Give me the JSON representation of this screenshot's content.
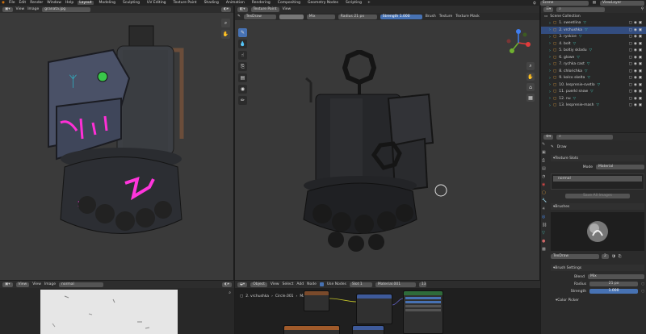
{
  "menu": {
    "items": [
      "File",
      "Edit",
      "Render",
      "Window",
      "Help"
    ],
    "workspaces": [
      "Layout",
      "Modeling",
      "Sculpting",
      "UV Editing",
      "Texture Paint",
      "Shading",
      "Animation",
      "Rendering",
      "Compositing",
      "Geometry Nodes",
      "Scripting"
    ],
    "active_workspace": "Layout",
    "scene_label": "Scene",
    "view_layer_label": "ViewLayer"
  },
  "left_viewport": {
    "header": {
      "view": "View",
      "image": "Image",
      "image_name": "granata.jpg"
    }
  },
  "texpaint_header": {
    "mode": "Texture Paint",
    "view": "View",
    "brush_name": "TexDraw",
    "blend": "Mix",
    "radius_label": "Radius",
    "radius_value": "21 px",
    "strength_label": "Strength",
    "strength_value": "1.000",
    "brush_menu": "Brush",
    "texture_menu": "Texture",
    "tex_mask_menu": "Texture Mask"
  },
  "outliner": {
    "title": "Scene Collection",
    "rows": [
      {
        "label": "1. sweetlina",
        "selected": false
      },
      {
        "label": "2. vrchushka",
        "selected": true
      },
      {
        "label": "3. ryskice",
        "selected": false
      },
      {
        "label": "4. bolt",
        "selected": false
      },
      {
        "label": "5. boltiy skladu",
        "selected": false
      },
      {
        "label": "6. glowe",
        "selected": false
      },
      {
        "label": "7. rychka cast",
        "selected": false
      },
      {
        "label": "8. chlorichka",
        "selected": false
      },
      {
        "label": "9. kolco skelta",
        "selected": false
      },
      {
        "label": "10. lesprenie-svetlo",
        "selected": false
      },
      {
        "label": "11. puerkl snow",
        "selected": false
      },
      {
        "label": "12. nu",
        "selected": false
      },
      {
        "label": "13. lesprenie-mash",
        "selected": false
      }
    ]
  },
  "properties": {
    "tool_name": "Draw",
    "texture_slots_label": "Texture Slots",
    "mode_label": "Mode",
    "mode_value": "Material",
    "slot_name": "normal",
    "save_images_label": "Save All Images",
    "brushes_label": "Brushes",
    "brush_name": "TexDraw",
    "brush_users": "2",
    "brush_settings_label": "Brush Settings",
    "blend_label": "Blend",
    "blend_value": "Mix",
    "radius_label": "Radius",
    "radius_value": "21 px",
    "strength_label": "Strength",
    "strength_value": "1.000",
    "color_picker_label": "Color Picker"
  },
  "image_editor": {
    "view": "View",
    "view2": "View",
    "image": "Image",
    "image_name": "normal"
  },
  "node_editor": {
    "object_mode": "Object",
    "view": "View",
    "select": "Select",
    "add": "Add",
    "node": "Node",
    "use_nodes": "Use Nodes",
    "slot": "Slot 1",
    "material": "Material.001",
    "users": "13",
    "breadcrumb_obj": "2. vrchushka",
    "breadcrumb_mesh": "Circle.001",
    "breadcrumb_mat": "Material.001"
  },
  "colors": {
    "accent_blue": "#4772b3",
    "selected_row": "#334d80",
    "teal": "#45c0b3"
  }
}
